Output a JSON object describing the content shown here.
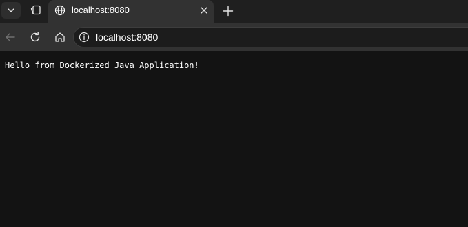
{
  "tab": {
    "title": "localhost:8080",
    "favicon_icon": "globe-icon",
    "close_icon": "close-icon"
  },
  "tabstrip": {
    "tab_actions_icon": "chevron-down-icon",
    "workspaces_icon": "workspaces-icon",
    "new_tab_icon": "plus-icon"
  },
  "toolbar": {
    "back_icon": "arrow-left-icon",
    "reload_icon": "reload-icon",
    "home_icon": "home-icon",
    "site_info_icon": "info-icon",
    "address": "localhost:8080"
  },
  "page": {
    "body_text": "Hello from Dockerized Java Application!"
  },
  "colors": {
    "tabstrip_bg": "#1f1f1f",
    "active_tab_bg": "#323232",
    "page_bg": "#131313",
    "text": "#ffffff"
  }
}
